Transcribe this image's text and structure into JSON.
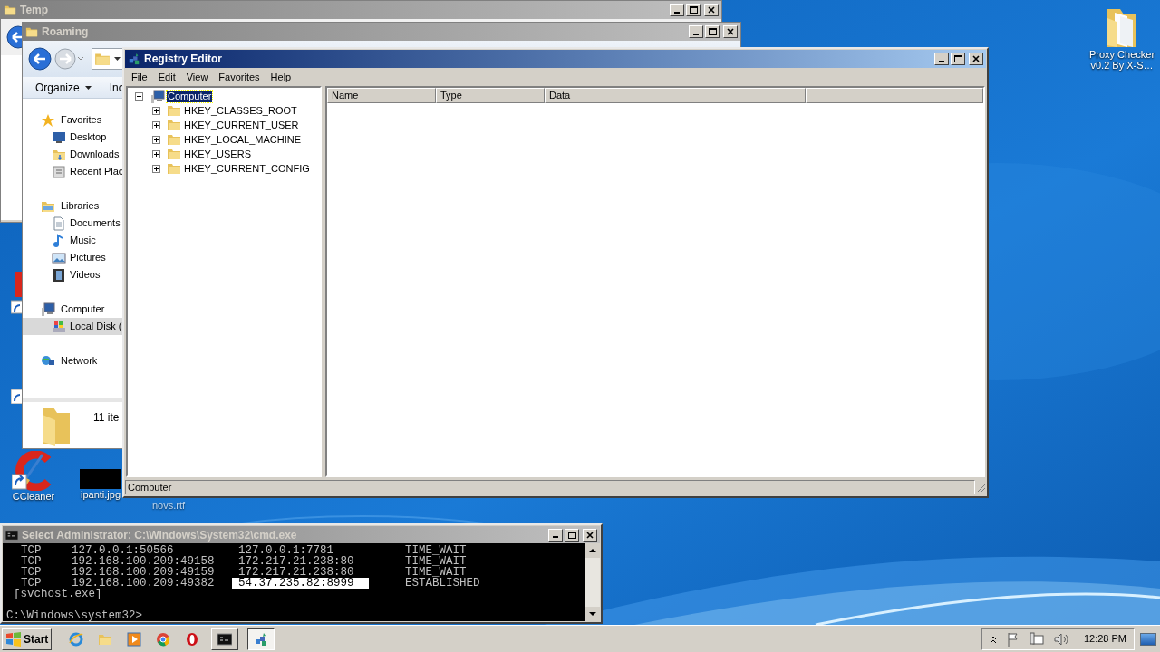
{
  "temp_window": {
    "title": "Temp"
  },
  "roaming_window": {
    "title": "Roaming",
    "toolbar": [
      {
        "label": "Organize",
        "has_menu": true
      },
      {
        "label": "Inc",
        "has_menu": false
      }
    ],
    "nav_groups": [
      {
        "label": "Favorites",
        "kind": "star",
        "selected": false,
        "children": [
          {
            "label": "Desktop",
            "kind": "desktop",
            "selected": false
          },
          {
            "label": "Downloads",
            "kind": "downloads",
            "selected": false
          },
          {
            "label": "Recent Plac",
            "kind": "recent",
            "selected": false
          }
        ]
      },
      {
        "label": "Libraries",
        "kind": "libraries",
        "selected": false,
        "children": [
          {
            "label": "Documents",
            "kind": "documents",
            "selected": false
          },
          {
            "label": "Music",
            "kind": "music",
            "selected": false
          },
          {
            "label": "Pictures",
            "kind": "pictures",
            "selected": false
          },
          {
            "label": "Videos",
            "kind": "videos",
            "selected": false
          }
        ]
      },
      {
        "label": "Computer",
        "kind": "computer",
        "selected": false,
        "children": [
          {
            "label": "Local Disk (",
            "kind": "disk",
            "selected": true
          }
        ]
      },
      {
        "label": "Network",
        "kind": "network",
        "selected": false
      }
    ],
    "details": {
      "count": "11 ite"
    }
  },
  "registry_editor": {
    "title": "Registry Editor",
    "menu": [
      "File",
      "Edit",
      "View",
      "Favorites",
      "Help"
    ],
    "tree": {
      "label": "Computer",
      "selected": true,
      "expanded": true,
      "children": [
        {
          "label": "HKEY_CLASSES_ROOT",
          "selected": false,
          "expanded": false
        },
        {
          "label": "HKEY_CURRENT_USER",
          "selected": false,
          "expanded": false
        },
        {
          "label": "HKEY_LOCAL_MACHINE",
          "selected": false,
          "expanded": false
        },
        {
          "label": "HKEY_USERS",
          "selected": false,
          "expanded": false
        },
        {
          "label": "HKEY_CURRENT_CONFIG",
          "selected": false,
          "expanded": false
        }
      ]
    },
    "columns": [
      "Name",
      "Type",
      "Data"
    ],
    "status": "Computer"
  },
  "console": {
    "title": "Select Administrator: C:\\Windows\\System32\\cmd.exe",
    "rows": [
      {
        "proto": "TCP",
        "local": "127.0.0.1:50566",
        "foreign": "127.0.0.1:7781",
        "state": "TIME_WAIT",
        "selected": false
      },
      {
        "proto": "TCP",
        "local": "192.168.100.209:49158",
        "foreign": "172.217.21.238:80",
        "state": "TIME_WAIT",
        "selected": false
      },
      {
        "proto": "TCP",
        "local": "192.168.100.209:49159",
        "foreign": "172.217.21.238:80",
        "state": "TIME_WAIT",
        "selected": false
      },
      {
        "proto": "TCP",
        "local": "192.168.100.209:49382",
        "foreign": "54.37.235.82:8999",
        "state": "ESTABLISHED",
        "selected": true
      }
    ],
    "process": "[svchost.exe]",
    "prompt": "C:\\Windows\\system32>"
  },
  "desktop_icons": [
    {
      "label": "CCleaner",
      "kind": "ccleaner"
    },
    {
      "label": "ipanti.jpg"
    },
    {
      "label": "novs.rtf",
      "kind": "document"
    },
    {
      "label": "Proxy Checker v0.2 By X-S…",
      "kind": "folder"
    }
  ],
  "taskbar": {
    "start": "Start",
    "items": [
      {
        "kind": "ie",
        "selected": false
      },
      {
        "kind": "explorer",
        "selected": false
      },
      {
        "kind": "media",
        "selected": false
      },
      {
        "kind": "chrome",
        "selected": false
      },
      {
        "kind": "opera",
        "selected": false
      },
      {
        "kind": "console",
        "selected": false
      },
      {
        "kind": "registry",
        "selected": true
      }
    ],
    "clock": "12:28 PM"
  }
}
